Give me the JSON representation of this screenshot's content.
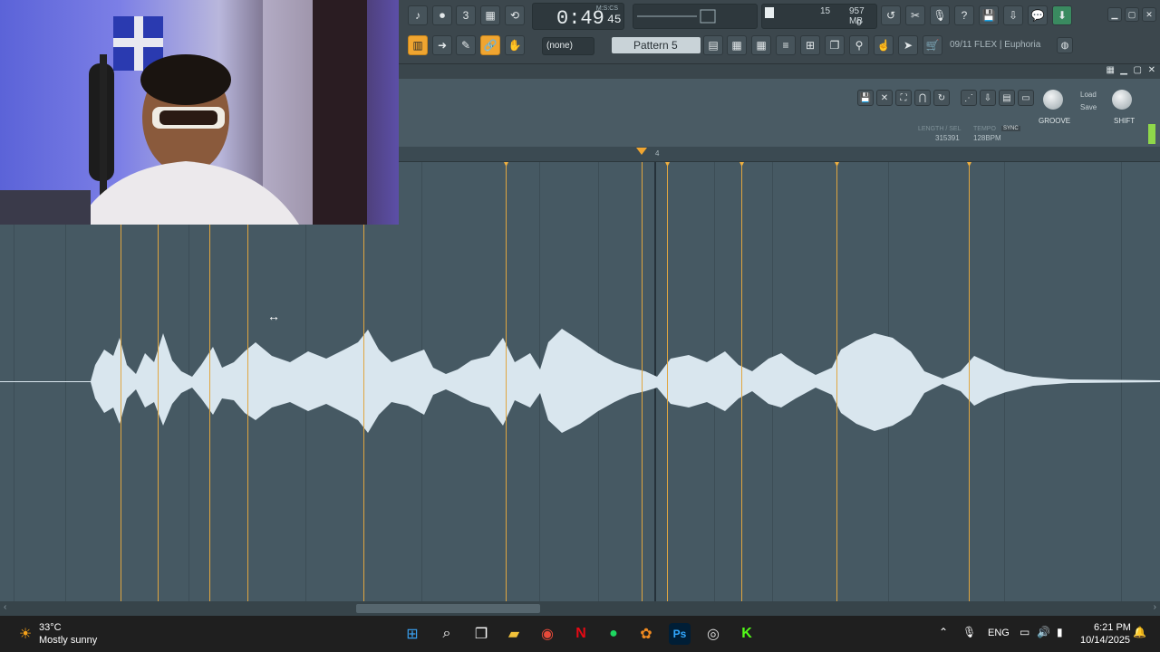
{
  "transport": {
    "time": "0:49",
    "time_sub": "45",
    "time_label": "M:S:CS"
  },
  "memory": {
    "cpu_value": "15",
    "mem": "957 MB",
    "poly": "0"
  },
  "pattern": {
    "snap": "(none)",
    "name": "Pattern 5"
  },
  "hint_bar": {
    "text": "09/11  FLEX | Euphoria"
  },
  "editor": {
    "length_label": "LENGTH / SEL",
    "length_value": "315391",
    "tempo_label": "TEMPO",
    "tempo_value": "128BPM",
    "sync_label": "SYNC",
    "groove_label": "GROOVE",
    "shift_label": "SHIFT",
    "load_label": "Load",
    "save_label": "Save",
    "timeline_marker": "4"
  },
  "taskbar": {
    "weather_temp": "33°C",
    "weather_desc": "Mostly sunny",
    "lang": "ENG",
    "time": "6:21 PM",
    "date": "10/14/2025"
  },
  "colors": {
    "accent": "#f0a530",
    "marker": "#e0a640",
    "waveform": "#d9e6ee",
    "background": "#465963"
  }
}
